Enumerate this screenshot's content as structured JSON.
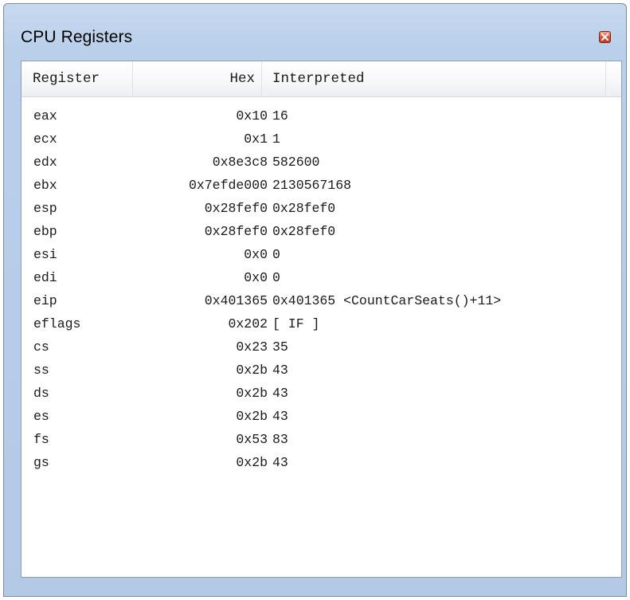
{
  "window": {
    "title": "CPU Registers",
    "close_icon": "close-icon"
  },
  "columns": {
    "register": "Register",
    "hex": "Hex",
    "interpreted": "Interpreted"
  },
  "registers": [
    {
      "name": "eax",
      "hex": "0x10",
      "interpreted": "16"
    },
    {
      "name": "ecx",
      "hex": "0x1",
      "interpreted": "1"
    },
    {
      "name": "edx",
      "hex": "0x8e3c8",
      "interpreted": "582600"
    },
    {
      "name": "ebx",
      "hex": "0x7efde000",
      "interpreted": "2130567168"
    },
    {
      "name": "esp",
      "hex": "0x28fef0",
      "interpreted": "0x28fef0"
    },
    {
      "name": "ebp",
      "hex": "0x28fef0",
      "interpreted": "0x28fef0"
    },
    {
      "name": "esi",
      "hex": "0x0",
      "interpreted": "0"
    },
    {
      "name": "edi",
      "hex": "0x0",
      "interpreted": "0"
    },
    {
      "name": "eip",
      "hex": "0x401365",
      "interpreted": "0x401365 <CountCarSeats()+11>"
    },
    {
      "name": "eflags",
      "hex": "0x202",
      "interpreted": "[ IF ]"
    },
    {
      "name": "cs",
      "hex": "0x23",
      "interpreted": "35"
    },
    {
      "name": "ss",
      "hex": "0x2b",
      "interpreted": "43"
    },
    {
      "name": "ds",
      "hex": "0x2b",
      "interpreted": "43"
    },
    {
      "name": "es",
      "hex": "0x2b",
      "interpreted": "43"
    },
    {
      "name": "fs",
      "hex": "0x53",
      "interpreted": "83"
    },
    {
      "name": "gs",
      "hex": "0x2b",
      "interpreted": "43"
    }
  ],
  "colors": {
    "window_frame": "#b9cfea",
    "close_button": "#d9573d"
  }
}
